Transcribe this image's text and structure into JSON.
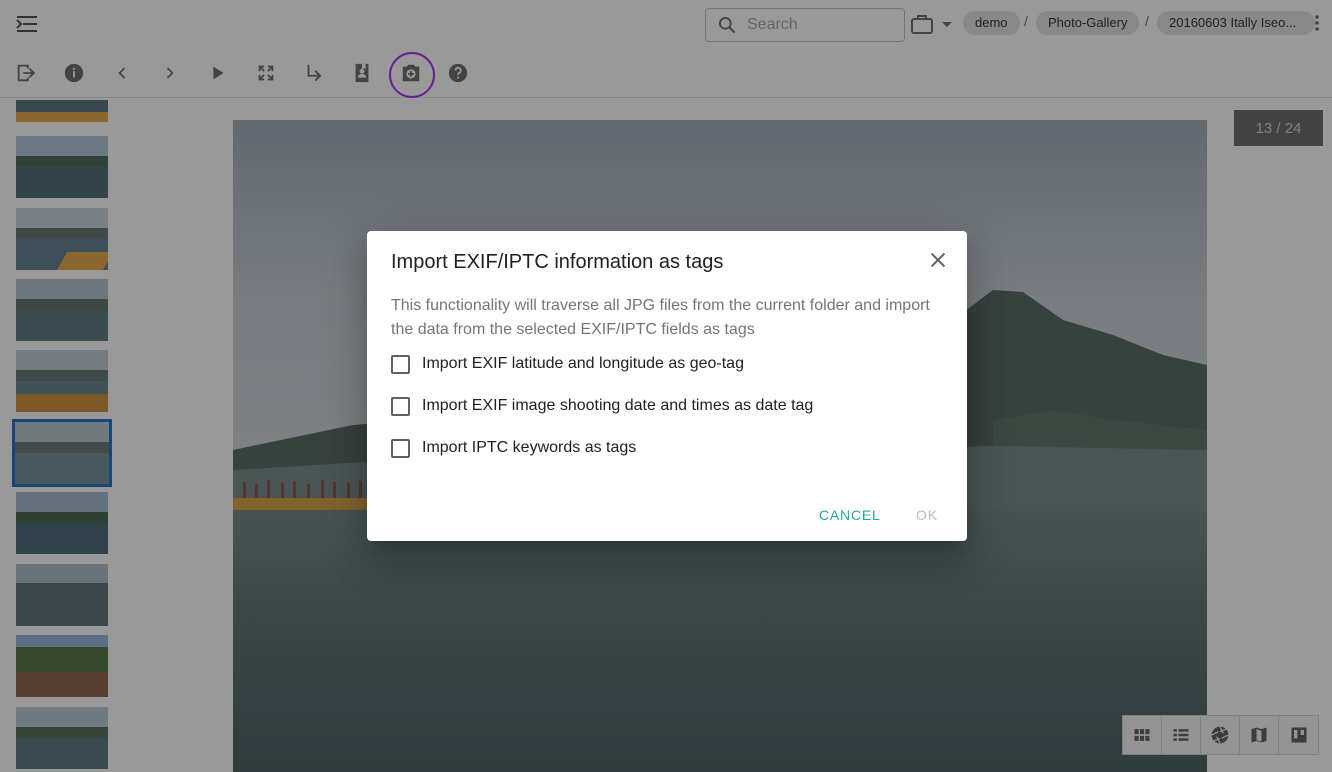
{
  "header": {
    "search_placeholder": "Search",
    "breadcrumbs": [
      "demo",
      "Photo-Gallery",
      "20160603 Itally Iseo..."
    ],
    "separator": "/"
  },
  "toolbar": {
    "buttons": [
      "exit-icon",
      "info-icon",
      "previous-icon",
      "next-icon",
      "play-icon",
      "fullscreen-icon",
      "move-icon",
      "portrait-icon",
      "camera-plus-icon",
      "help-icon"
    ],
    "highlighted": "camera-plus-icon"
  },
  "viewer": {
    "counter": "13 / 24",
    "thumbnail_count": 10,
    "active_thumbnail_index": 4
  },
  "views": [
    "grid-view-icon",
    "list-view-icon",
    "aperture-icon",
    "map-icon",
    "board-icon"
  ],
  "dialog": {
    "title": "Import EXIF/IPTC information as tags",
    "description": "This functionality will traverse all JPG files from the current folder and import the data from the selected EXIF/IPTC fields as tags",
    "options": [
      {
        "label": "Import EXIF latitude and longitude as geo-tag",
        "checked": false
      },
      {
        "label": "Import EXIF image shooting date and times as date tag",
        "checked": false
      },
      {
        "label": "Import IPTC keywords as tags",
        "checked": false
      }
    ],
    "cancel_label": "CANCEL",
    "ok_label": "OK",
    "ok_enabled": false
  },
  "colors": {
    "accent": "#26a69a",
    "highlight_ring": "#a020f0",
    "active_thumb_border": "#1565c0"
  }
}
